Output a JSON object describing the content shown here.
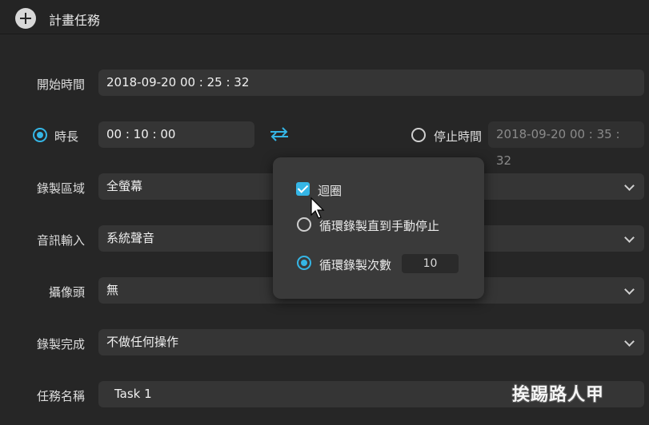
{
  "window": {
    "title": "計畫任務"
  },
  "start_time": {
    "label": "開始時間",
    "value": "2018-09-20 00 : 25 : 32"
  },
  "duration": {
    "label": "時長",
    "value": "00 : 10 : 00",
    "selected": true
  },
  "stop_time": {
    "label": "停止時間",
    "value": "2018-09-20 00 : 35 : 32",
    "selected": false
  },
  "record_area": {
    "label": "錄製區域",
    "value": "全螢幕"
  },
  "audio_input": {
    "label": "音訊輸入",
    "value": "系統聲音"
  },
  "camera": {
    "label": "攝像頭",
    "value": "無"
  },
  "record_complete": {
    "label": "錄製完成",
    "value": "不做任何操作"
  },
  "task_name": {
    "label": "任務名稱",
    "value": "Task 1"
  },
  "loop_popup": {
    "loop_label": "迴圈",
    "loop_checked": true,
    "until_manual_label": "循環錄製直到手動停止",
    "count_label": "循環錄製次數",
    "count_value": "10"
  },
  "watermark": {
    "text": "挨踢路人甲"
  },
  "colors": {
    "accent": "#35b6e6",
    "background": "#262626",
    "field": "#353535",
    "popup": "#3a3a3a"
  }
}
